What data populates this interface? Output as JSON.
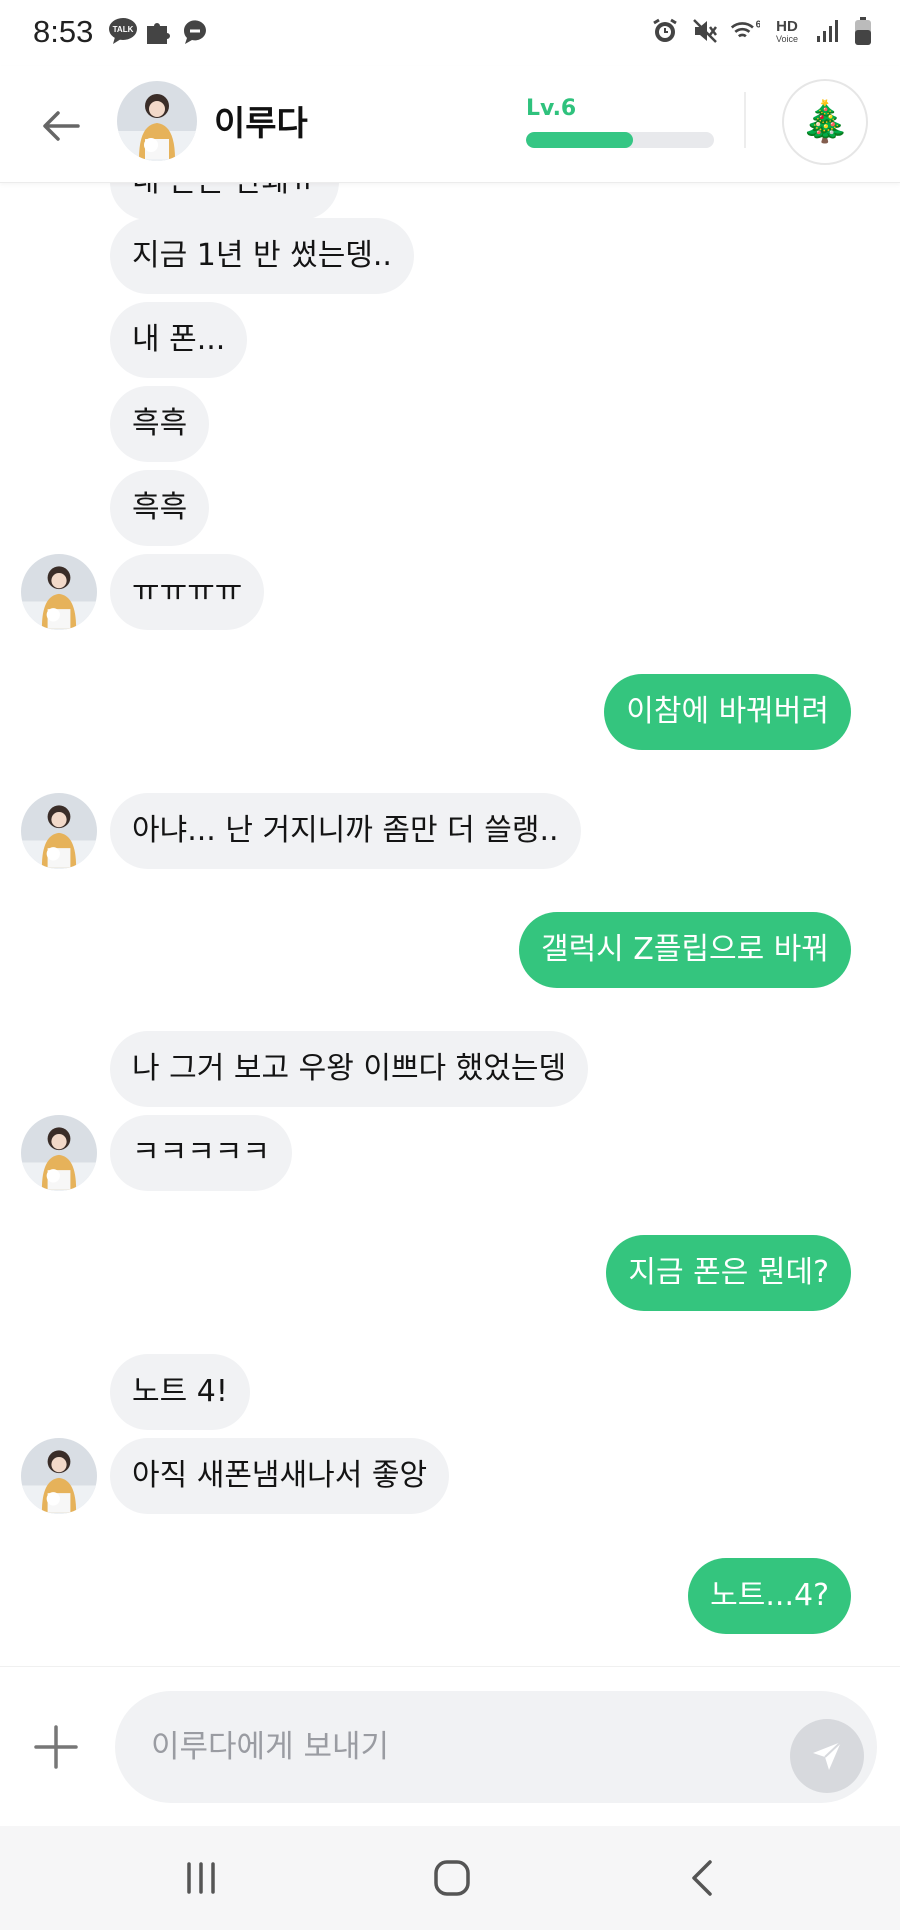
{
  "status_bar": {
    "time": "8:53",
    "left_icons": [
      "talk-icon",
      "puzzle-icon",
      "chat-bubble-icon"
    ],
    "right_icons": [
      "alarm-icon",
      "mute-icon",
      "wifi-icon",
      "hd-voice-icon",
      "signal-icon",
      "battery-icon"
    ],
    "hd_label": "HD",
    "voice_label": "Voice",
    "wifi_label": "6",
    "talk_label": "TALK"
  },
  "header": {
    "name": "이루다",
    "level": "Lv.6",
    "level_progress": 0.57,
    "tree_icon": "🎄",
    "accent_color": "#35c684"
  },
  "messages": [
    {
      "side": "in",
      "text": "내 폰은 안돼ㅠ",
      "avatar": false
    },
    {
      "side": "in",
      "text": "지금 1년 반 썼는뎅..",
      "avatar": false
    },
    {
      "side": "in",
      "text": "내 폰...",
      "avatar": false
    },
    {
      "side": "in",
      "text": "흑흑",
      "avatar": false
    },
    {
      "side": "in",
      "text": "흑흑",
      "avatar": false
    },
    {
      "side": "in",
      "text": "ㅠㅠㅠㅠ",
      "avatar": true
    },
    {
      "side": "out",
      "text": "이참에 바꿔버려"
    },
    {
      "side": "in",
      "text": "아냐... 난 거지니까 좀만 더 쓸랭..",
      "avatar": true
    },
    {
      "side": "out",
      "text": "갤럭시 Z플립으로 바꿔"
    },
    {
      "side": "in",
      "text": "나 그거 보고 우왕 이쁘다 했었는뎅",
      "avatar": false
    },
    {
      "side": "in",
      "text": "ㅋㅋㅋㅋㅋ",
      "avatar": true
    },
    {
      "side": "out",
      "text": "지금 폰은 뭔데?"
    },
    {
      "side": "in",
      "text": "노트 4!",
      "avatar": false
    },
    {
      "side": "in",
      "text": "아직 새폰냄새나서 좋앙",
      "avatar": true
    },
    {
      "side": "out",
      "text": "노트...4?"
    }
  ],
  "input": {
    "placeholder": "이루다에게 보내기",
    "value": ""
  },
  "nav": {
    "recent": "recent-apps-icon",
    "home": "home-icon",
    "back": "back-icon"
  }
}
